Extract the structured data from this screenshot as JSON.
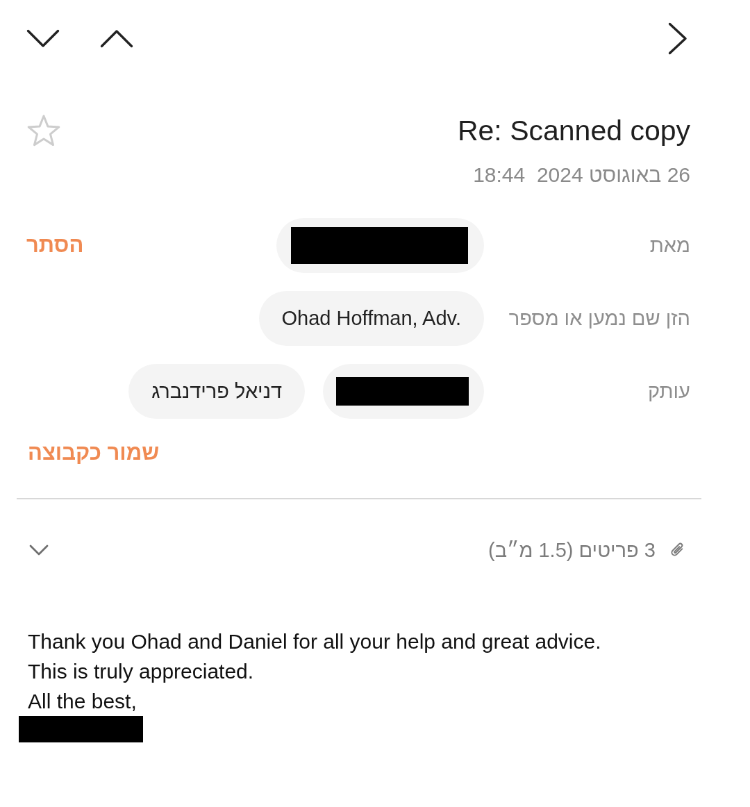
{
  "message": {
    "title": "Re: Scanned copy",
    "starred": false,
    "date": "26 באוגוסט 2024  18:44"
  },
  "recipients": [
    {
      "kind": "from",
      "label": "מאת",
      "chips": [
        {
          "kind": "redacted"
        }
      ],
      "action": "הסתר"
    },
    {
      "kind": "to",
      "label": "הזן שם נמען או מספר",
      "chips": [
        {
          "kind": "contact",
          "text": "Ohad Hoffman, Adv."
        }
      ]
    },
    {
      "kind": "cc",
      "label": "עותק",
      "chips": [
        {
          "kind": "redacted"
        },
        {
          "kind": "contact",
          "text": "דניאל פרידנברג"
        }
      ]
    }
  ],
  "save_group": "שמור כקבוצה",
  "attachments": {
    "summary": "3 פריטים (1.5 מ״ב)",
    "expanded": false
  },
  "body": {
    "lines": [
      "Thank you Ohad and Daniel for all your help and great advice.",
      "This is truly appreciated.",
      "All the best,"
    ],
    "signature_redacted": true
  }
}
